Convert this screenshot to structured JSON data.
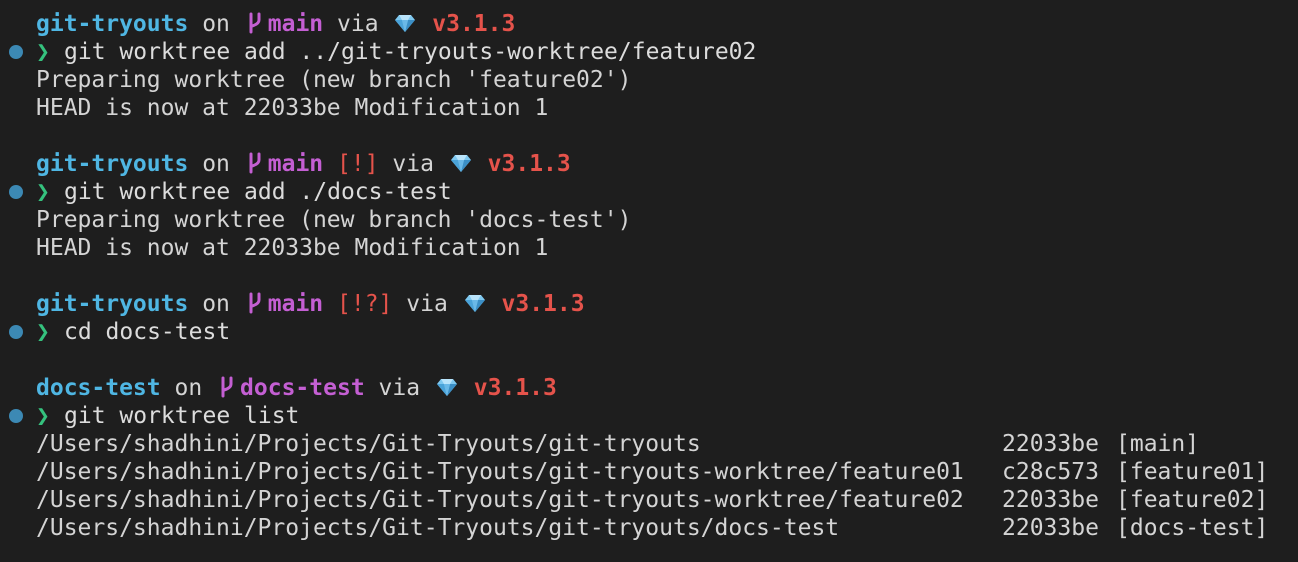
{
  "blocks": [
    {
      "prompt": {
        "dir": "git-tryouts",
        "on": "on",
        "branch": "main",
        "status": "",
        "via": "via",
        "version": "v3.1.3"
      },
      "command": "git worktree add ../git-tryouts-worktree/feature02",
      "output": [
        "Preparing worktree (new branch 'feature02')",
        "HEAD is now at 22033be Modification 1"
      ]
    },
    {
      "prompt": {
        "dir": "git-tryouts",
        "on": "on",
        "branch": "main",
        "status": "[!]",
        "via": "via",
        "version": "v3.1.3"
      },
      "command": "git worktree add ./docs-test",
      "output": [
        "Preparing worktree (new branch 'docs-test')",
        "HEAD is now at 22033be Modification 1"
      ]
    },
    {
      "prompt": {
        "dir": "git-tryouts",
        "on": "on",
        "branch": "main",
        "status": "[!?]",
        "via": "via",
        "version": "v3.1.3"
      },
      "command": "cd docs-test",
      "output": []
    },
    {
      "prompt": {
        "dir": "docs-test",
        "on": "on",
        "branch": "docs-test",
        "status": "",
        "via": "via",
        "version": "v3.1.3"
      },
      "command": "git worktree list",
      "output": []
    }
  ],
  "prompt_symbol": "❯",
  "worktrees": [
    {
      "path": "/Users/shadhini/Projects/Git-Tryouts/git-tryouts",
      "sha": "22033be",
      "branch": "[main]"
    },
    {
      "path": "/Users/shadhini/Projects/Git-Tryouts/git-tryouts-worktree/feature01",
      "sha": "c28c573",
      "branch": "[feature01]"
    },
    {
      "path": "/Users/shadhini/Projects/Git-Tryouts/git-tryouts-worktree/feature02",
      "sha": "22033be",
      "branch": "[feature02]"
    },
    {
      "path": "/Users/shadhini/Projects/Git-Tryouts/git-tryouts/docs-test",
      "sha": "22033be",
      "branch": "[docs-test]"
    }
  ],
  "colors": {
    "background": "#1e1e1e",
    "directory": "#4fb6e3",
    "branch": "#c45fd3",
    "status": "#e5534b",
    "version": "#e5534b",
    "prompt_arrow": "#35c27e",
    "command_marker": "#3c89b4"
  },
  "icons": {
    "branch": "git-branch-icon",
    "ruby": "ruby-gem-icon",
    "command_marker": "command-status-dot-icon"
  }
}
